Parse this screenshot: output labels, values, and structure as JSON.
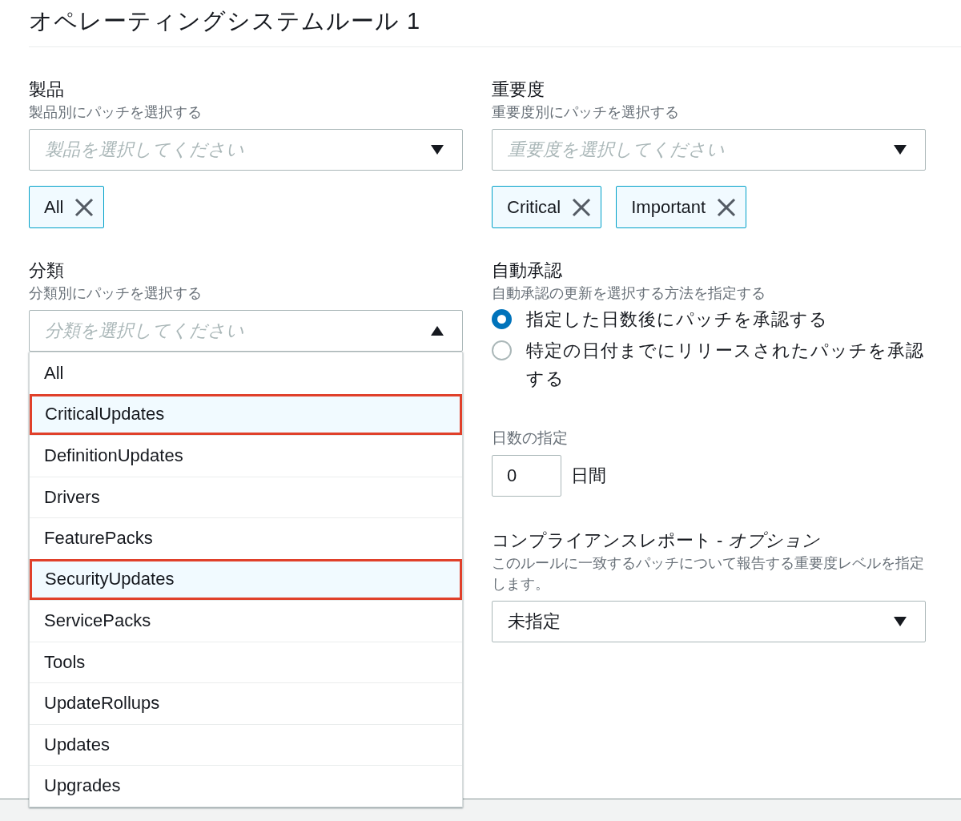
{
  "title": "オペレーティングシステムルール 1",
  "columns": [
    {
      "sections": [
        {
          "kind": "multiselect",
          "label": "製品",
          "description": "製品別にパッチを選択する",
          "placeholder": "製品を選択してください",
          "expanded": false,
          "tokens": [
            {
              "label": "All"
            }
          ]
        },
        {
          "kind": "multiselect",
          "label": "分類",
          "description": "分類別にパッチを選択する",
          "placeholder": "分類を選択してください",
          "expanded": true,
          "options": [
            {
              "label": "All",
              "selected": false
            },
            {
              "label": "CriticalUpdates",
              "selected": true
            },
            {
              "label": "DefinitionUpdates",
              "selected": false
            },
            {
              "label": "Drivers",
              "selected": false
            },
            {
              "label": "FeaturePacks",
              "selected": false
            },
            {
              "label": "SecurityUpdates",
              "selected": true
            },
            {
              "label": "ServicePacks",
              "selected": false
            },
            {
              "label": "Tools",
              "selected": false
            },
            {
              "label": "UpdateRollups",
              "selected": false
            },
            {
              "label": "Updates",
              "selected": false
            },
            {
              "label": "Upgrades",
              "selected": false
            }
          ]
        }
      ]
    },
    {
      "sections": [
        {
          "kind": "multiselect",
          "label": "重要度",
          "description": "重要度別にパッチを選択する",
          "placeholder": "重要度を選択してください",
          "expanded": false,
          "tokens": [
            {
              "label": "Critical"
            },
            {
              "label": "Important"
            }
          ]
        },
        {
          "kind": "radio",
          "label": "自動承認",
          "description": "自動承認の更新を選択する方法を指定する",
          "options": [
            {
              "label": "指定した日数後にパッチを承認する",
              "selected": true
            },
            {
              "label": "特定の日付までにリリースされたパッチを承認する",
              "selected": false
            }
          ]
        },
        {
          "kind": "number",
          "label": "日数の指定",
          "value": "0",
          "unit": "日間"
        },
        {
          "kind": "select",
          "label": "コンプライアンスレポート - *オプション*",
          "description": "このルールに一致するパッチについて報告する重要度レベルを指定します。",
          "value": "未指定"
        }
      ]
    }
  ]
}
